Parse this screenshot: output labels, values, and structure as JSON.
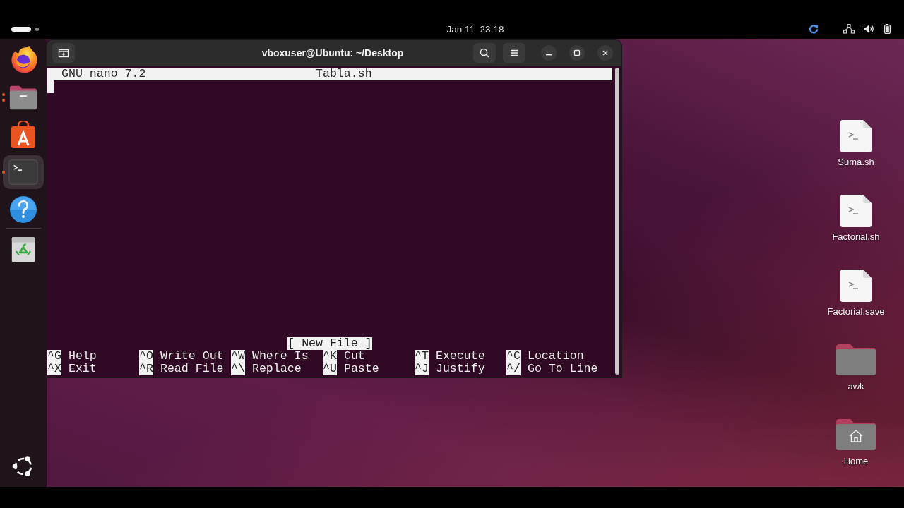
{
  "top_bar": {
    "clock": "Jan 11  23:18"
  },
  "dock": {
    "items": [
      {
        "kind": "browser",
        "running": false,
        "selected": false
      },
      {
        "kind": "files",
        "running": true,
        "multiple_windows": true,
        "selected": false
      },
      {
        "kind": "app_store",
        "running": false,
        "selected": false
      },
      {
        "kind": "terminal",
        "running": true,
        "multiple_windows": false,
        "selected": true
      },
      {
        "kind": "help",
        "running": false,
        "selected": false
      },
      {
        "kind": "trash",
        "running": false,
        "selected": false
      }
    ]
  },
  "terminal_window": {
    "title": "vboxuser@Ubuntu: ~/Desktop",
    "nano": {
      "version": "GNU nano 7.2",
      "filename": "Tabla.sh",
      "status": "[ New File ]",
      "shortcuts": [
        {
          "key": "^G",
          "label": "Help"
        },
        {
          "key": "^O",
          "label": "Write Out"
        },
        {
          "key": "^W",
          "label": "Where Is"
        },
        {
          "key": "^K",
          "label": "Cut"
        },
        {
          "key": "^T",
          "label": "Execute"
        },
        {
          "key": "^C",
          "label": "Location"
        },
        {
          "key": "^X",
          "label": "Exit"
        },
        {
          "key": "^R",
          "label": "Read File"
        },
        {
          "key": "^\\",
          "label": "Replace"
        },
        {
          "key": "^U",
          "label": "Paste"
        },
        {
          "key": "^J",
          "label": "Justify"
        },
        {
          "key": "^/",
          "label": "Go To Line"
        }
      ]
    }
  },
  "desktop_icons": [
    {
      "label": "Suma.sh",
      "kind": "script"
    },
    {
      "label": "Factorial.sh",
      "kind": "script"
    },
    {
      "label": "Factorial.save",
      "kind": "script"
    },
    {
      "label": "awk",
      "kind": "folder"
    },
    {
      "label": "Home",
      "kind": "home"
    }
  ]
}
